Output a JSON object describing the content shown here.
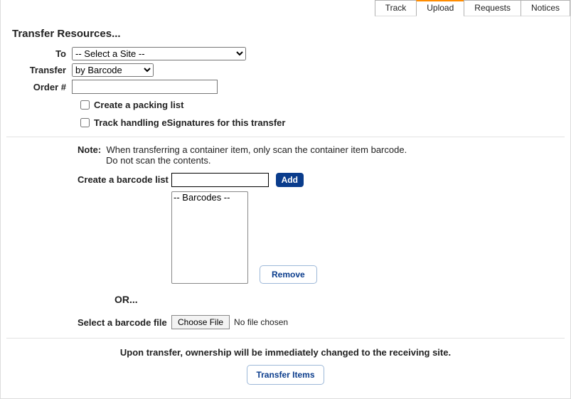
{
  "tabs": {
    "track": "Track",
    "upload": "Upload",
    "requests": "Requests",
    "notices": "Notices"
  },
  "page": {
    "title": "Transfer Resources..."
  },
  "labels": {
    "to": "To",
    "transfer": "Transfer",
    "order": "Order #",
    "packing": "Create a packing list",
    "esig": "Track handling eSignatures for this transfer",
    "note": "Note:",
    "note_text": "When transferring a container item, only scan the container item barcode.",
    "note_sub": "Do not scan the contents.",
    "create_list": "Create a barcode list",
    "add": "Add",
    "barcodes_option": "-- Barcodes --",
    "remove": "Remove",
    "or": "OR...",
    "select_file": "Select a barcode file",
    "choose_file": "Choose File",
    "no_file": "No file chosen",
    "footer": "Upon transfer, ownership will be immediately changed to the receiving site.",
    "transfer_btn": "Transfer Items"
  },
  "selects": {
    "site": "-- Select a Site --",
    "mode": "by Barcode"
  }
}
